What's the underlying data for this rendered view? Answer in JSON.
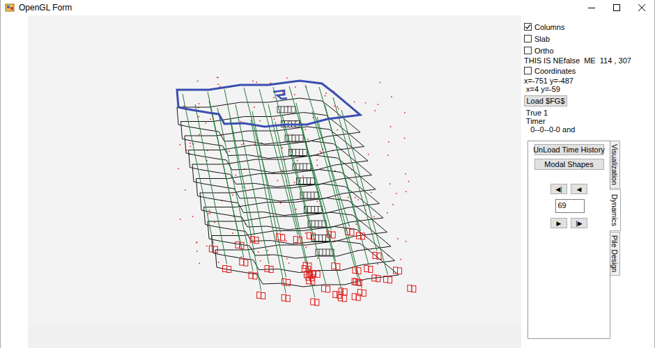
{
  "window": {
    "title": "OpenGL Form"
  },
  "options": [
    {
      "label": "Columns",
      "checked": true
    },
    {
      "label": "Slab",
      "checked": false
    },
    {
      "label": "Ortho",
      "checked": false
    }
  ],
  "status_text": "THIS IS NEfalse  ME  114 , 307",
  "coordinates": {
    "label": "Coordinates",
    "checked": false
  },
  "cursor_lines": [
    "x=-751 y=-487",
    " x=4 y=-59"
  ],
  "load_button": "Load $FG$",
  "info_lines": [
    " True 1",
    " Timer",
    "   0--0--0-0 and"
  ],
  "tabs": [
    {
      "label": "Visualization",
      "selected": false
    },
    {
      "label": "Dynamics",
      "selected": true
    },
    {
      "label": "Pile Design",
      "selected": false
    }
  ],
  "dynamics": {
    "buttons": [
      "UnLoad Time History",
      "Modal Shapes"
    ],
    "nav_back": [
      "◀|",
      "◀"
    ],
    "frame": "69",
    "nav_forward": [
      "▶",
      "|▶"
    ]
  }
}
